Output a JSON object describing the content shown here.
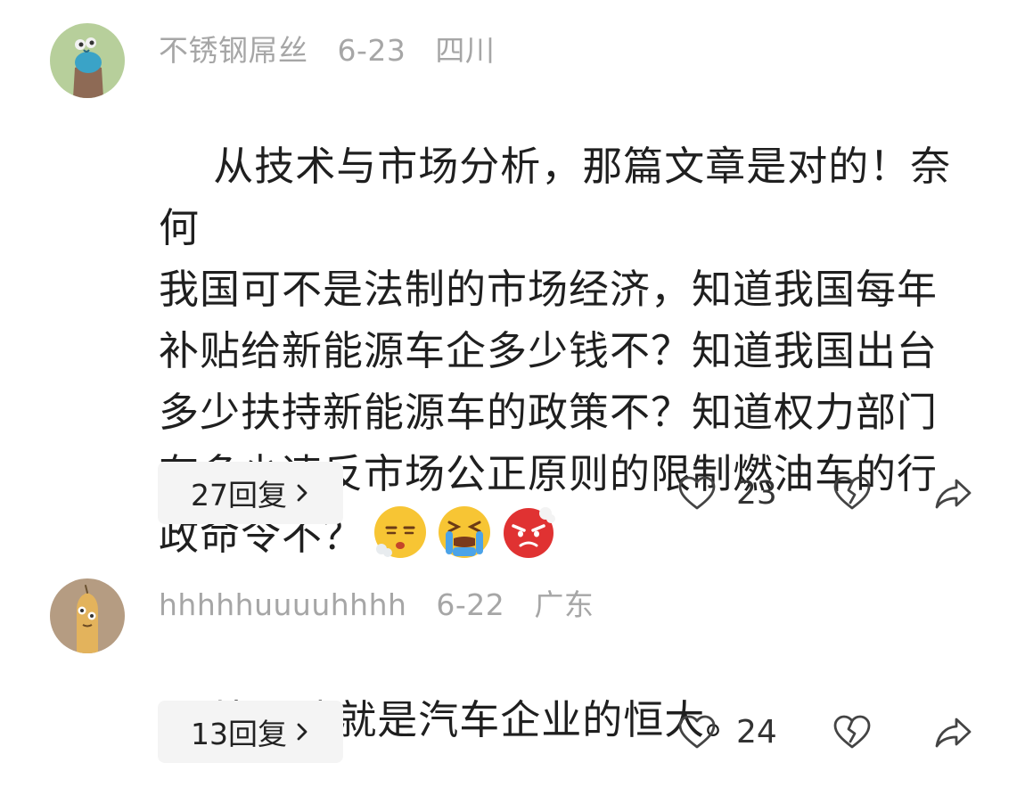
{
  "comments": [
    {
      "username": "不锈钢屌丝",
      "date": "6-23",
      "location": "四川",
      "text": "从技术与市场分析，那篇文章是对的！奈何\n我国可不是法制的市场经济，知道我国每年\n补贴给新能源车企多少钱不？知道我国出台\n多少扶持新能源车的政策不？知道权力部门\n有多少违反市场公正原则的限制燃油车的行\n政命令不？",
      "emojis": [
        "exhausted-face-icon",
        "tired-crying-face-icon",
        "angry-face-icon"
      ],
      "reply_label": "27回复",
      "likes": "23"
    },
    {
      "username": "hhhhhuuuuhhhh",
      "date": "6-22",
      "location": "广东",
      "text": "比亚迪就是汽车企业的恒大。",
      "reply_label": "13回复",
      "likes": "24"
    }
  ],
  "colors": {
    "meta_text": "#a6a6a6",
    "body_text": "#1f1f1f",
    "reply_bg": "#f4f4f4"
  }
}
